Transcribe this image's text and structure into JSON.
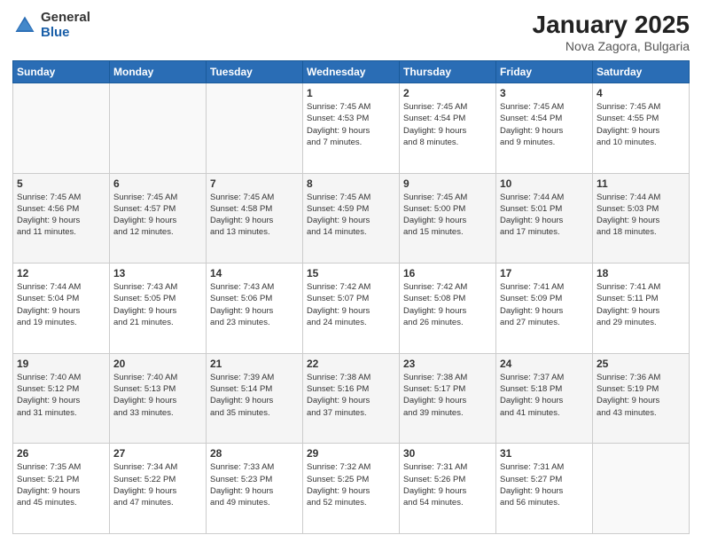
{
  "logo": {
    "general": "General",
    "blue": "Blue"
  },
  "header": {
    "title": "January 2025",
    "subtitle": "Nova Zagora, Bulgaria"
  },
  "weekdays": [
    "Sunday",
    "Monday",
    "Tuesday",
    "Wednesday",
    "Thursday",
    "Friday",
    "Saturday"
  ],
  "weeks": [
    [
      {
        "day": "",
        "info": ""
      },
      {
        "day": "",
        "info": ""
      },
      {
        "day": "",
        "info": ""
      },
      {
        "day": "1",
        "info": "Sunrise: 7:45 AM\nSunset: 4:53 PM\nDaylight: 9 hours\nand 7 minutes."
      },
      {
        "day": "2",
        "info": "Sunrise: 7:45 AM\nSunset: 4:54 PM\nDaylight: 9 hours\nand 8 minutes."
      },
      {
        "day": "3",
        "info": "Sunrise: 7:45 AM\nSunset: 4:54 PM\nDaylight: 9 hours\nand 9 minutes."
      },
      {
        "day": "4",
        "info": "Sunrise: 7:45 AM\nSunset: 4:55 PM\nDaylight: 9 hours\nand 10 minutes."
      }
    ],
    [
      {
        "day": "5",
        "info": "Sunrise: 7:45 AM\nSunset: 4:56 PM\nDaylight: 9 hours\nand 11 minutes."
      },
      {
        "day": "6",
        "info": "Sunrise: 7:45 AM\nSunset: 4:57 PM\nDaylight: 9 hours\nand 12 minutes."
      },
      {
        "day": "7",
        "info": "Sunrise: 7:45 AM\nSunset: 4:58 PM\nDaylight: 9 hours\nand 13 minutes."
      },
      {
        "day": "8",
        "info": "Sunrise: 7:45 AM\nSunset: 4:59 PM\nDaylight: 9 hours\nand 14 minutes."
      },
      {
        "day": "9",
        "info": "Sunrise: 7:45 AM\nSunset: 5:00 PM\nDaylight: 9 hours\nand 15 minutes."
      },
      {
        "day": "10",
        "info": "Sunrise: 7:44 AM\nSunset: 5:01 PM\nDaylight: 9 hours\nand 17 minutes."
      },
      {
        "day": "11",
        "info": "Sunrise: 7:44 AM\nSunset: 5:03 PM\nDaylight: 9 hours\nand 18 minutes."
      }
    ],
    [
      {
        "day": "12",
        "info": "Sunrise: 7:44 AM\nSunset: 5:04 PM\nDaylight: 9 hours\nand 19 minutes."
      },
      {
        "day": "13",
        "info": "Sunrise: 7:43 AM\nSunset: 5:05 PM\nDaylight: 9 hours\nand 21 minutes."
      },
      {
        "day": "14",
        "info": "Sunrise: 7:43 AM\nSunset: 5:06 PM\nDaylight: 9 hours\nand 23 minutes."
      },
      {
        "day": "15",
        "info": "Sunrise: 7:42 AM\nSunset: 5:07 PM\nDaylight: 9 hours\nand 24 minutes."
      },
      {
        "day": "16",
        "info": "Sunrise: 7:42 AM\nSunset: 5:08 PM\nDaylight: 9 hours\nand 26 minutes."
      },
      {
        "day": "17",
        "info": "Sunrise: 7:41 AM\nSunset: 5:09 PM\nDaylight: 9 hours\nand 27 minutes."
      },
      {
        "day": "18",
        "info": "Sunrise: 7:41 AM\nSunset: 5:11 PM\nDaylight: 9 hours\nand 29 minutes."
      }
    ],
    [
      {
        "day": "19",
        "info": "Sunrise: 7:40 AM\nSunset: 5:12 PM\nDaylight: 9 hours\nand 31 minutes."
      },
      {
        "day": "20",
        "info": "Sunrise: 7:40 AM\nSunset: 5:13 PM\nDaylight: 9 hours\nand 33 minutes."
      },
      {
        "day": "21",
        "info": "Sunrise: 7:39 AM\nSunset: 5:14 PM\nDaylight: 9 hours\nand 35 minutes."
      },
      {
        "day": "22",
        "info": "Sunrise: 7:38 AM\nSunset: 5:16 PM\nDaylight: 9 hours\nand 37 minutes."
      },
      {
        "day": "23",
        "info": "Sunrise: 7:38 AM\nSunset: 5:17 PM\nDaylight: 9 hours\nand 39 minutes."
      },
      {
        "day": "24",
        "info": "Sunrise: 7:37 AM\nSunset: 5:18 PM\nDaylight: 9 hours\nand 41 minutes."
      },
      {
        "day": "25",
        "info": "Sunrise: 7:36 AM\nSunset: 5:19 PM\nDaylight: 9 hours\nand 43 minutes."
      }
    ],
    [
      {
        "day": "26",
        "info": "Sunrise: 7:35 AM\nSunset: 5:21 PM\nDaylight: 9 hours\nand 45 minutes."
      },
      {
        "day": "27",
        "info": "Sunrise: 7:34 AM\nSunset: 5:22 PM\nDaylight: 9 hours\nand 47 minutes."
      },
      {
        "day": "28",
        "info": "Sunrise: 7:33 AM\nSunset: 5:23 PM\nDaylight: 9 hours\nand 49 minutes."
      },
      {
        "day": "29",
        "info": "Sunrise: 7:32 AM\nSunset: 5:25 PM\nDaylight: 9 hours\nand 52 minutes."
      },
      {
        "day": "30",
        "info": "Sunrise: 7:31 AM\nSunset: 5:26 PM\nDaylight: 9 hours\nand 54 minutes."
      },
      {
        "day": "31",
        "info": "Sunrise: 7:31 AM\nSunset: 5:27 PM\nDaylight: 9 hours\nand 56 minutes."
      },
      {
        "day": "",
        "info": ""
      }
    ]
  ]
}
